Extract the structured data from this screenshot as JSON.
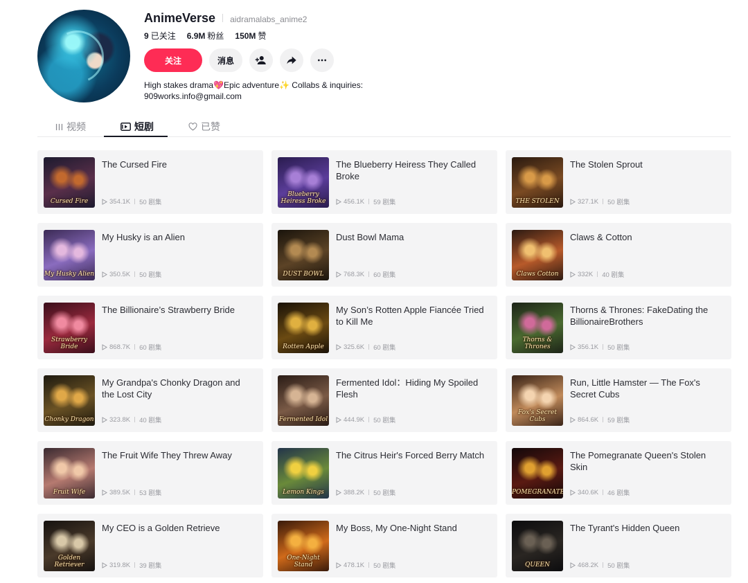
{
  "profile": {
    "name": "AnimeVerse",
    "handle": "aidramalabs_anime2",
    "following_count": "9",
    "following_label": "已关注",
    "followers_count": "6.9M",
    "followers_label": "粉丝",
    "likes_count": "150M",
    "likes_label": "赞",
    "bio_line1": "High stakes drama💖Epic adventure✨ Collabs & inquiries:",
    "bio_line2": "909works.info@gmail.com"
  },
  "actions": {
    "follow_label": "关注",
    "message_label": "消息",
    "follow_color": "#fe2c55"
  },
  "tabs": [
    {
      "label": "视频",
      "icon": "grid-icon",
      "active": false
    },
    {
      "label": "短剧",
      "icon": "playlist-icon",
      "active": true
    },
    {
      "label": "已赞",
      "icon": "heart-outline-icon",
      "active": false
    }
  ],
  "dramas": [
    {
      "title": "The Cursed Fire",
      "views": "354.1K",
      "episodes": "50 剧集",
      "cover_caption": "Cursed Fire",
      "colors": [
        "#1c1a2e",
        "#5a2f4a",
        "#c2692e"
      ]
    },
    {
      "title": "The Blueberry Heiress They Called Broke",
      "views": "456.1K",
      "episodes": "59 剧集",
      "cover_caption": "Blueberry Heiress Broke",
      "colors": [
        "#2a1c4f",
        "#5b3d9a",
        "#a77fd6"
      ]
    },
    {
      "title": "The Stolen Sprout",
      "views": "327.1K",
      "episodes": "50 剧集",
      "cover_caption": "THE STOLEN",
      "colors": [
        "#2a1a10",
        "#7a4a22",
        "#d89a48"
      ]
    },
    {
      "title": "My Husky is an Alien",
      "views": "350.5K",
      "episodes": "50 剧集",
      "cover_caption": "My Husky Alien",
      "colors": [
        "#3b2a55",
        "#8a6cbf",
        "#e4b8de"
      ]
    },
    {
      "title": "Dust Bowl Mama",
      "views": "768.3K",
      "episodes": "60 剧集",
      "cover_caption": "DUST BOWL",
      "colors": [
        "#1a140c",
        "#5c4326",
        "#b38a52"
      ]
    },
    {
      "title": "Claws & Cotton",
      "views": "332K",
      "episodes": "40 剧集",
      "cover_caption": "Claws Cotton",
      "colors": [
        "#2c1a12",
        "#b85a2a",
        "#f0c070"
      ]
    },
    {
      "title": "The Billionaire’s Strawberry Bride",
      "views": "868.7K",
      "episodes": "60 剧集",
      "cover_caption": "Strawberry Bride",
      "colors": [
        "#3a0e1a",
        "#9a2a3e",
        "#f08aa0"
      ]
    },
    {
      "title": "My Son’s Rotten Apple Fiancée Tried to Kill Me",
      "views": "325.6K",
      "episodes": "60 剧集",
      "cover_caption": "Rotten Apple",
      "colors": [
        "#1a1208",
        "#6b4a12",
        "#e0b040"
      ]
    },
    {
      "title": "Thorns & Thrones: FakeDating the BillionaireBrothers",
      "views": "356.1K",
      "episodes": "50 剧集",
      "cover_caption": "Thorns & Thrones",
      "colors": [
        "#1d2418",
        "#4a6a30",
        "#d06a9a"
      ]
    },
    {
      "title": "My Grandpa's Chonky Dragon and the Lost City",
      "views": "323.8K",
      "episodes": "40 剧集",
      "cover_caption": "Chonky Dragon",
      "colors": [
        "#1e1a10",
        "#6b5224",
        "#e0a848"
      ]
    },
    {
      "title": "Fermented Idol：Hiding My Spoiled Flesh",
      "views": "444.9K",
      "episodes": "50 剧集",
      "cover_caption": "Fermented Idol",
      "colors": [
        "#2a1c16",
        "#7a5a46",
        "#d6b494"
      ]
    },
    {
      "title": "Run, Little Hamster — The Fox's Secret Cubs",
      "views": "864.6K",
      "episodes": "59 剧集",
      "cover_caption": "Fox's Secret Cubs",
      "colors": [
        "#3a2418",
        "#c08a5a",
        "#f4d4b0"
      ]
    },
    {
      "title": "The Fruit Wife They Threw Away",
      "views": "389.5K",
      "episodes": "53 剧集",
      "cover_caption": "Fruit Wife",
      "colors": [
        "#3a2a30",
        "#b67a70",
        "#f0c8a8"
      ]
    },
    {
      "title": "The Citrus Heir's Forced Berry Match",
      "views": "388.2K",
      "episodes": "50 剧集",
      "cover_caption": "Lemon Kings",
      "colors": [
        "#22344a",
        "#6a8a3a",
        "#f0d040"
      ]
    },
    {
      "title": "The Pomegranate Queen's Stolen Skin",
      "views": "340.6K",
      "episodes": "46 剧集",
      "cover_caption": "POMEGRANATE",
      "colors": [
        "#12080a",
        "#5a1a12",
        "#e0a030"
      ]
    },
    {
      "title": "My CEO is a Golden Retrieve",
      "views": "319.8K",
      "episodes": "39 剧集",
      "cover_caption": "Golden Retriever",
      "colors": [
        "#161210",
        "#4a3a2a",
        "#d8c8a8"
      ]
    },
    {
      "title": "My Boss, My One-Night Stand",
      "views": "478.1K",
      "episodes": "50 剧集",
      "cover_caption": "One-Night Stand",
      "colors": [
        "#3a1a0a",
        "#d06a1a",
        "#f4b040"
      ]
    },
    {
      "title": "The Tyrant's Hidden Queen",
      "views": "468.2K",
      "episodes": "50 剧集",
      "cover_caption": "QUEEN",
      "colors": [
        "#0c0c0e",
        "#2a2622",
        "#6a6054"
      ]
    }
  ]
}
